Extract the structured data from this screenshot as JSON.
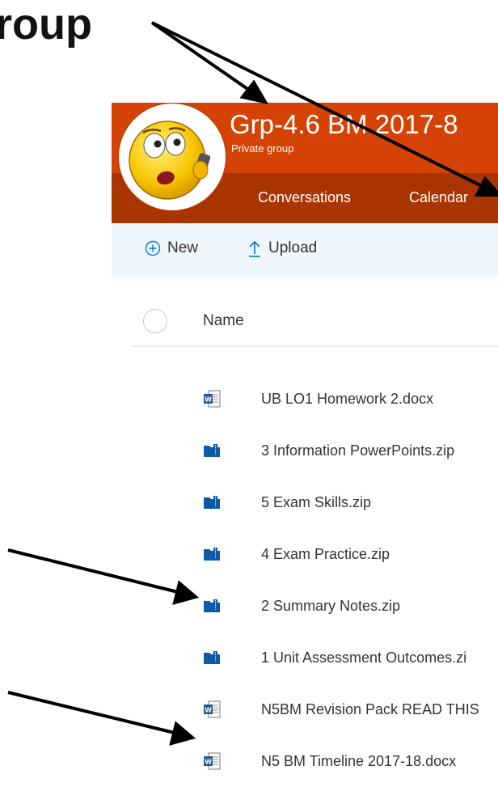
{
  "slide": {
    "title": "roup"
  },
  "group": {
    "name": "Grp-4.6 BM 2017-8",
    "privacy": "Private group",
    "header_color": "#d44204",
    "band_color": "#a93503",
    "tabs": [
      {
        "label": "Conversations"
      },
      {
        "label": "Calendar"
      }
    ]
  },
  "commands": {
    "new_label": "New",
    "upload_label": "Upload",
    "accent": "#0078d4"
  },
  "files": {
    "column_name": "Name",
    "rows": [
      {
        "name": "UB LO1 Homework 2.docx",
        "icon": "word-doc-icon"
      },
      {
        "name": "3 Information PowerPoints.zip",
        "icon": "zip-folder-icon"
      },
      {
        "name": "5 Exam Skills.zip",
        "icon": "zip-folder-icon"
      },
      {
        "name": "4 Exam Practice.zip",
        "icon": "zip-folder-icon"
      },
      {
        "name": "2 Summary Notes.zip",
        "icon": "zip-folder-icon"
      },
      {
        "name": "1 Unit Assessment Outcomes.zi",
        "icon": "zip-folder-icon"
      },
      {
        "name": "N5BM Revision Pack READ THIS",
        "icon": "word-doc-icon"
      },
      {
        "name": "N5 BM Timeline 2017-18.docx",
        "icon": "word-doc-icon"
      }
    ]
  }
}
